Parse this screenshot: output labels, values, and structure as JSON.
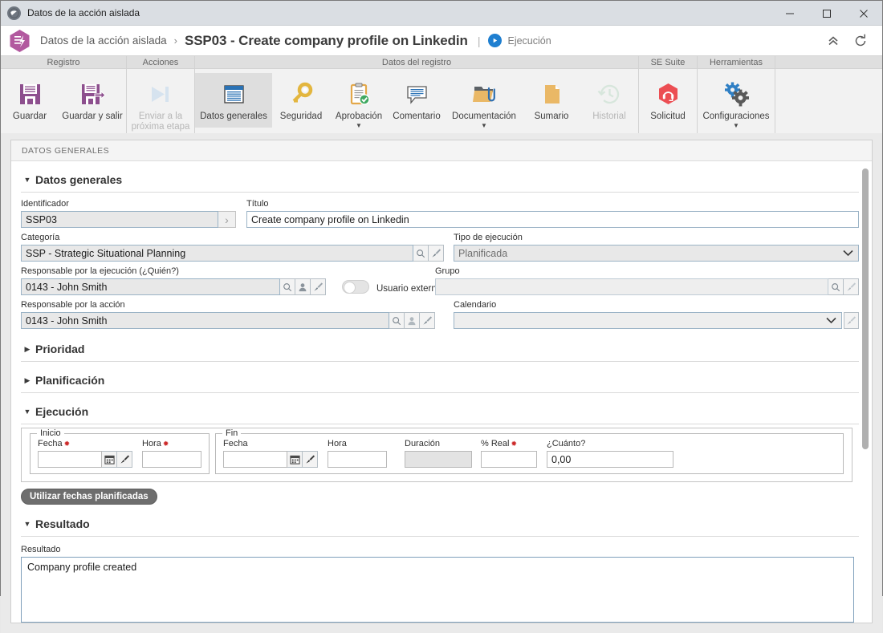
{
  "window": {
    "title": "Datos de la acción aislada",
    "icon": "globe-icon",
    "minimize": "−",
    "maximize": "□",
    "close": "✕"
  },
  "header": {
    "app_icon": "hexagon-action-icon",
    "breadcrumb_root": "Datos de la acción aislada",
    "breadcrumb_separator": "›",
    "record_title": "SSP03 - Create company profile on Linkedin",
    "divider": "|",
    "stage_icon": "play-icon",
    "stage_label": "Ejecución",
    "collapse_icon": "chevron-double-up-icon",
    "refresh_icon": "refresh-icon"
  },
  "ribbon": {
    "groups": [
      {
        "title": "Registro",
        "buttons": [
          {
            "label": "Guardar",
            "icon": "save-icon",
            "state": "enabled"
          },
          {
            "label": "Guardar y salir",
            "icon": "save-and-exit-icon",
            "state": "enabled"
          }
        ]
      },
      {
        "title": "Acciones",
        "buttons": [
          {
            "label": "Enviar a la próxima etapa",
            "icon": "next-stage-icon",
            "state": "disabled"
          }
        ]
      },
      {
        "title": "Datos del registro",
        "buttons": [
          {
            "label": "Datos generales",
            "icon": "general-data-icon",
            "state": "selected"
          },
          {
            "label": "Seguridad",
            "icon": "key-icon",
            "state": "enabled"
          },
          {
            "label": "Aprobación",
            "icon": "approval-clipboard-icon",
            "state": "enabled",
            "dropdown": true
          },
          {
            "label": "Comentario",
            "icon": "comment-icon",
            "state": "enabled"
          },
          {
            "label": "Documentación",
            "icon": "documentation-folder-icon",
            "state": "enabled",
            "dropdown": true
          },
          {
            "label": "Sumario",
            "icon": "summary-page-icon",
            "state": "enabled"
          },
          {
            "label": "Historial",
            "icon": "history-clock-icon",
            "state": "disabled"
          }
        ]
      },
      {
        "title": "SE Suite",
        "buttons": [
          {
            "label": "Solicitud",
            "icon": "support-headset-icon",
            "state": "enabled"
          }
        ]
      },
      {
        "title": "Herramientas",
        "buttons": [
          {
            "label": "Configuraciones",
            "icon": "gears-icon",
            "state": "enabled",
            "dropdown": true
          }
        ]
      }
    ]
  },
  "panel": {
    "header": "DATOS GENERALES"
  },
  "sections": {
    "datos_generales": {
      "title": "Datos generales",
      "expanded": true,
      "arrow": "▼",
      "fields": {
        "identificador": {
          "label": "Identificador",
          "value": "SSP03",
          "button_icon": "chevron-right-icon"
        },
        "titulo": {
          "label": "Título",
          "value": "Create company profile on Linkedin"
        },
        "categoria": {
          "label": "Categoría",
          "value": "SSP - Strategic Situational Planning",
          "icons": [
            "search-icon",
            "brush-icon"
          ]
        },
        "tipo_de_ejecucion": {
          "label": "Tipo de ejecución",
          "value": "Planificada",
          "options": [
            "Planificada"
          ]
        },
        "responsable_ejecucion": {
          "label": "Responsable por la ejecución (¿Quién?)",
          "value": "0143 - John Smith",
          "icons": [
            "search-icon",
            "user-icon",
            "brush-icon"
          ]
        },
        "usuario_externo": {
          "label": "Usuario externo",
          "state": "off"
        },
        "grupo": {
          "label": "Grupo",
          "value": "",
          "icons": [
            "search-icon",
            "brush-icon"
          ]
        },
        "responsable_accion": {
          "label": "Responsable por la acción",
          "value": "0143 - John Smith",
          "icons": [
            "search-icon",
            "user-icon",
            "brush-icon"
          ]
        },
        "calendario": {
          "label": "Calendario",
          "value": "",
          "icons": [
            "brush-icon"
          ]
        }
      }
    },
    "prioridad": {
      "title": "Prioridad",
      "expanded": false,
      "arrow": "▶"
    },
    "planificacion": {
      "title": "Planificación",
      "expanded": false,
      "arrow": "▶"
    },
    "ejecucion": {
      "title": "Ejecución",
      "expanded": true,
      "arrow": "▼",
      "inicio": {
        "legend": "Inicio",
        "fecha": {
          "label": "Fecha",
          "required": true,
          "value": "",
          "icons": [
            "calendar-icon",
            "brush-icon"
          ]
        },
        "hora": {
          "label": "Hora",
          "required": true,
          "value": ""
        }
      },
      "fin": {
        "legend": "Fin",
        "fecha": {
          "label": "Fecha",
          "required": false,
          "value": "",
          "icons": [
            "calendar-icon",
            "brush-icon"
          ]
        },
        "hora": {
          "label": "Hora",
          "required": false,
          "value": ""
        }
      },
      "duracion": {
        "label": "Duración",
        "value": "",
        "readonly": true
      },
      "pct_real": {
        "label": "% Real",
        "required": true,
        "value": ""
      },
      "cuanto": {
        "label": "¿Cuánto?",
        "value": "0,00"
      },
      "boton_fechas": "Utilizar fechas planificadas"
    },
    "resultado": {
      "title": "Resultado",
      "expanded": true,
      "arrow": "▼",
      "field": {
        "label": "Resultado",
        "value": "Company profile created"
      }
    }
  },
  "colors": {
    "accent_purple": "#8d4f8e",
    "brand_hex": "#b2599f",
    "play_blue": "#1f7fd0",
    "required_red": "#cc2a2a",
    "selected_tab_bg": "#dedede",
    "field_border_blue": "#9bb3c6"
  }
}
